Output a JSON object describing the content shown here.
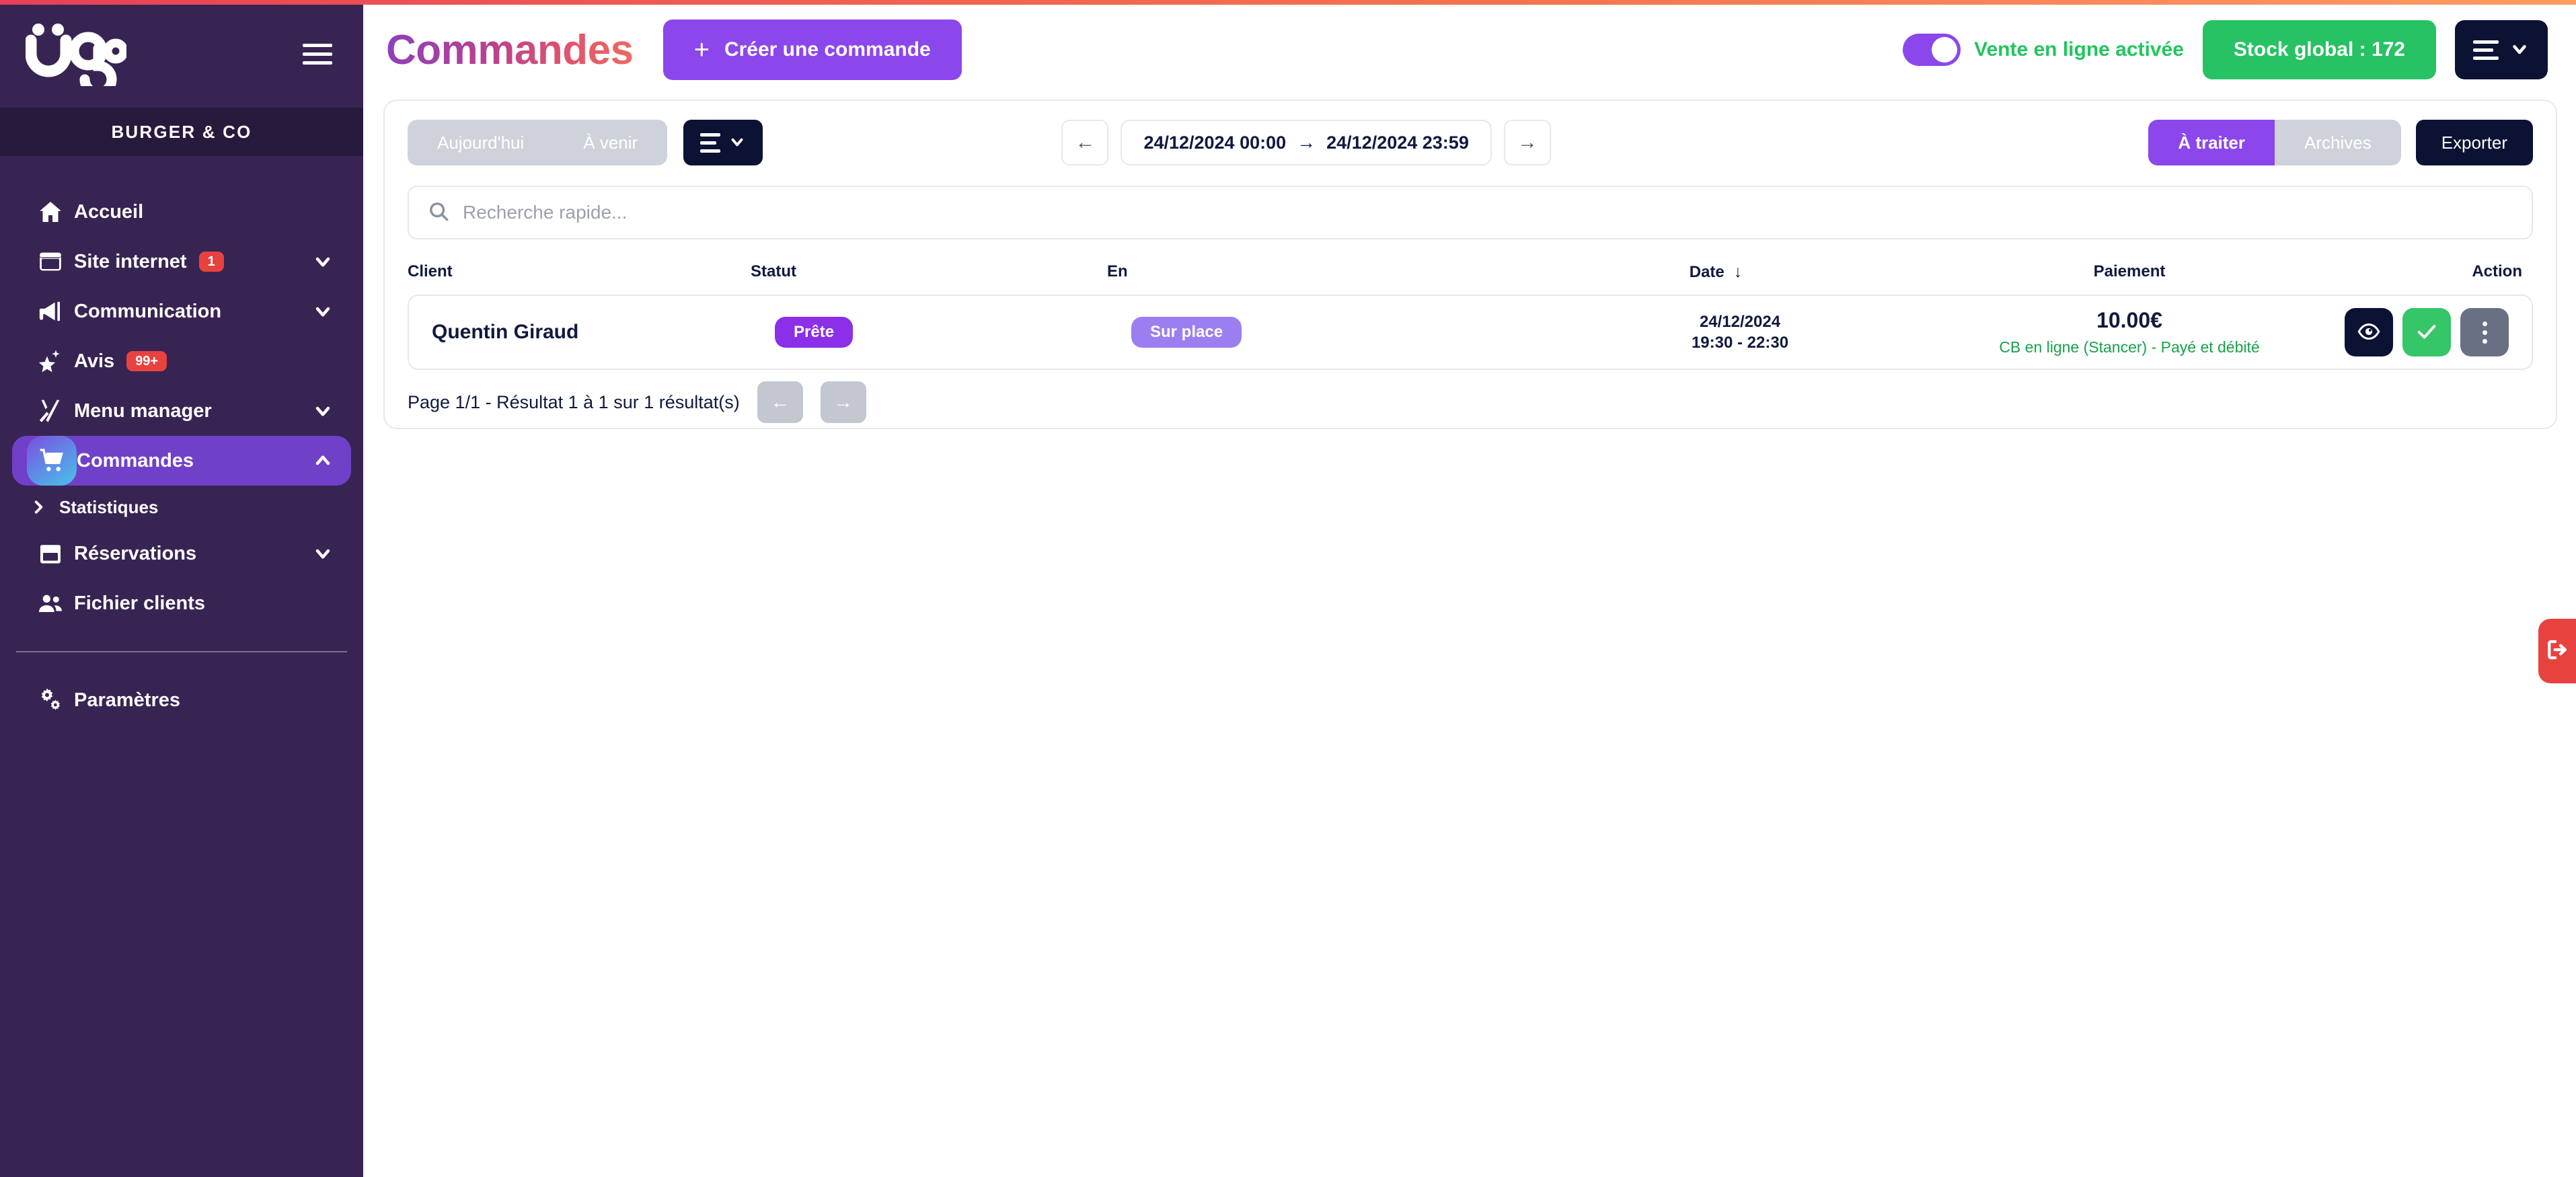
{
  "brand": {
    "logo_text": "ugo",
    "restaurant_name": "BURGER & CO"
  },
  "sidebar": {
    "items": [
      {
        "label": "Accueil",
        "icon": "home-icon",
        "badge": null,
        "chevron": null,
        "active": false
      },
      {
        "label": "Site internet",
        "icon": "browser-icon",
        "badge": "1",
        "chevron": "down",
        "active": false
      },
      {
        "label": "Communication",
        "icon": "megaphone-icon",
        "badge": null,
        "chevron": "down",
        "active": false
      },
      {
        "label": "Avis",
        "icon": "sparkle-star-icon",
        "badge": "99+",
        "chevron": null,
        "active": false
      },
      {
        "label": "Menu manager",
        "icon": "fork-knife-icon",
        "badge": null,
        "chevron": "down",
        "active": false
      },
      {
        "label": "Commandes",
        "icon": "shopping-cart-icon",
        "badge": null,
        "chevron": "up",
        "active": true
      }
    ],
    "sub_item": {
      "label": "Statistiques",
      "icon": "chevron-right-icon"
    },
    "items_after": [
      {
        "label": "Réservations",
        "icon": "calendar-icon",
        "badge": null,
        "chevron": "down",
        "active": false
      },
      {
        "label": "Fichier clients",
        "icon": "users-icon",
        "badge": null,
        "chevron": null,
        "active": false
      }
    ],
    "footer_items": [
      {
        "label": "Paramètres",
        "icon": "gears-icon",
        "badge": null,
        "chevron": null,
        "active": false
      }
    ]
  },
  "header": {
    "title": "Commandes",
    "create_button": "Créer une commande",
    "create_button_plus": "+",
    "online_sales_toggle_label": "Vente en ligne activée",
    "online_sales_toggle_on": true,
    "stock_button": "Stock global : 172"
  },
  "toolbar": {
    "segments": [
      {
        "label": "Aujourd'hui",
        "selected": false
      },
      {
        "label": "À venir",
        "selected": false
      }
    ],
    "date_range": {
      "start": "24/12/2024 00:00",
      "separator": "→",
      "end": "24/12/2024 23:59",
      "prev_arrow": "←",
      "next_arrow": "→"
    },
    "view_segments": [
      {
        "label": "À traiter",
        "selected": true
      },
      {
        "label": "Archives",
        "selected": false
      }
    ],
    "export_button": "Exporter"
  },
  "search": {
    "placeholder": "Recherche rapide...",
    "value": ""
  },
  "table": {
    "columns": [
      "Client",
      "Statut",
      "En",
      "Date",
      "Paiement",
      "Action"
    ],
    "sort_column": "Date",
    "sort_direction": "↓",
    "rows": [
      {
        "client": "Quentin Giraud",
        "statut": "Prête",
        "en": "Sur place",
        "date": "24/12/2024",
        "time_range": "19:30 - 22:30",
        "amount": "10.00€",
        "payment_method": "CB en ligne (Stancer) - Payé et débité",
        "actions": [
          "eye-icon",
          "check-icon",
          "three-dots-icon"
        ]
      }
    ]
  },
  "pagination": {
    "label": "Page 1/1 - Résultat 1 à 1 sur 1 résultat(s)",
    "prev": "←",
    "next": "→"
  },
  "floating": {
    "logout_icon": "logout-icon"
  },
  "colors": {
    "sidebar_bg": "#372453",
    "sidebar_brand_bg": "#271a3d",
    "accent_purple": "#8b46ec",
    "accent_green": "#27c263",
    "accent_navy": "#0b1234",
    "badge_red": "#e8423f",
    "status_prete": "#8b2fe8",
    "status_surplace": "#9b7ff0",
    "payment_green": "#19a14b"
  }
}
